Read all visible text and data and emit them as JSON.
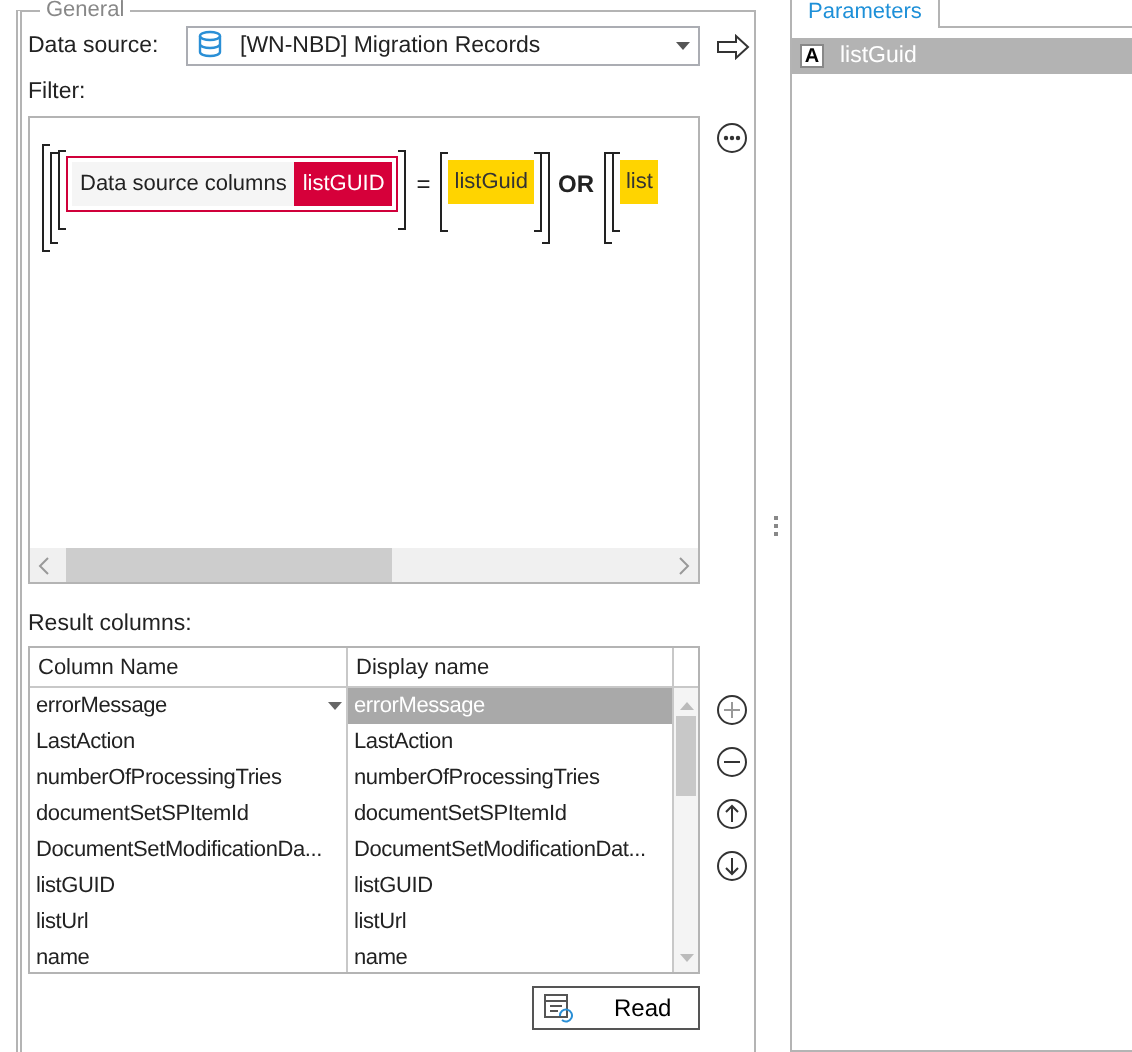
{
  "group_title": "General",
  "data_source": {
    "label": "Data source:",
    "value": "[WN-NBD] Migration Records"
  },
  "filter": {
    "label": "Filter:",
    "column_field": "Data source columns",
    "column_tag": "listGUID",
    "operator": "=",
    "value": "listGuid",
    "connector": "OR",
    "next_value": "list"
  },
  "result_columns": {
    "label": "Result columns:",
    "columns": [
      "Column Name",
      "Display name"
    ],
    "rows": [
      {
        "column_name": "errorMessage",
        "display_name": "errorMessage",
        "selected": true
      },
      {
        "column_name": "LastAction",
        "display_name": "LastAction",
        "selected": false
      },
      {
        "column_name": "numberOfProcessingTries",
        "display_name": "numberOfProcessingTries",
        "selected": false
      },
      {
        "column_name": "documentSetSPItemId",
        "display_name": "documentSetSPItemId",
        "selected": false
      },
      {
        "column_name": "DocumentSetModificationDa...",
        "display_name": "DocumentSetModificationDat...",
        "selected": false
      },
      {
        "column_name": "listGUID",
        "display_name": "listGUID",
        "selected": false
      },
      {
        "column_name": "listUrl",
        "display_name": "listUrl",
        "selected": false
      },
      {
        "column_name": "name",
        "display_name": "name",
        "selected": false
      }
    ]
  },
  "read_button": "Read",
  "parameters": {
    "tab": "Parameters",
    "items": [
      {
        "type_icon": "A",
        "name": "listGuid",
        "selected": true
      }
    ]
  }
}
